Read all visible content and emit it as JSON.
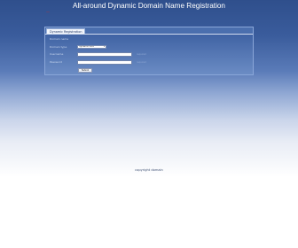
{
  "header": {
    "logo_text": "—",
    "title": "All-around Dynamic Domain Name Registration"
  },
  "panel": {
    "tab_label": "Dynamic Registration",
    "rows": [
      {
        "label": "Domain name"
      },
      {
        "label": "Domain type",
        "select_value": "dynamic-dns"
      },
      {
        "label": "Username",
        "hint": "required"
      },
      {
        "label": "Password",
        "hint": "required"
      }
    ],
    "submit_label": "Submit"
  },
  "footer": {
    "text": "copyright domain"
  }
}
